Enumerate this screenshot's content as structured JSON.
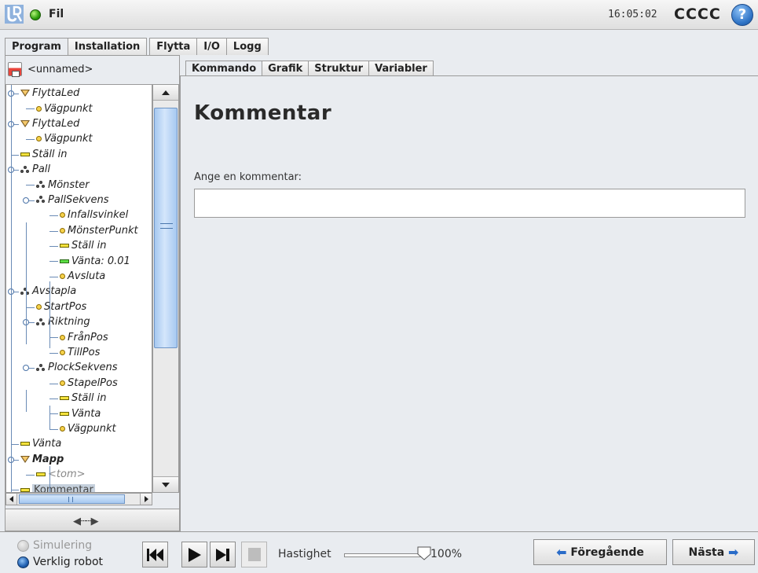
{
  "topbar": {
    "menu_label": "Fil",
    "clock": "16:05:02",
    "robot_name": "CCCC",
    "help_symbol": "?"
  },
  "main_tabs": [
    "Program",
    "Installation",
    "Flytta",
    "I/O",
    "Logg"
  ],
  "program": {
    "name": "<unnamed>"
  },
  "tree": [
    {
      "label": "FlyttaLed",
      "icon": "move-icon"
    },
    {
      "label": "Vägpunkt",
      "icon": "waypoint-icon"
    },
    {
      "label": "FlyttaLed",
      "icon": "move-icon"
    },
    {
      "label": "Vägpunkt",
      "icon": "waypoint-icon"
    },
    {
      "label": "Ställ in",
      "icon": "set-icon"
    },
    {
      "label": "Pall",
      "icon": "pallet-icon"
    },
    {
      "label": "Mönster",
      "icon": "pallet-icon"
    },
    {
      "label": "PallSekvens",
      "icon": "pallet-icon"
    },
    {
      "label": "Infallsvinkel",
      "icon": "waypoint-icon"
    },
    {
      "label": "MönsterPunkt",
      "icon": "waypoint-icon"
    },
    {
      "label": "Ställ in",
      "icon": "set-icon"
    },
    {
      "label": "Vänta: 0.01",
      "icon": "wait-icon"
    },
    {
      "label": "Avsluta",
      "icon": "waypoint-icon"
    },
    {
      "label": "Avstapla",
      "icon": "pallet-icon"
    },
    {
      "label": "StartPos",
      "icon": "waypoint-icon"
    },
    {
      "label": "Riktning",
      "icon": "pallet-icon"
    },
    {
      "label": "FrånPos",
      "icon": "waypoint-icon"
    },
    {
      "label": "TillPos",
      "icon": "waypoint-icon"
    },
    {
      "label": "PlockSekvens",
      "icon": "pallet-icon"
    },
    {
      "label": "StapelPos",
      "icon": "waypoint-icon"
    },
    {
      "label": "Ställ in",
      "icon": "set-icon"
    },
    {
      "label": "Vänta",
      "icon": "set-icon"
    },
    {
      "label": "Vägpunkt",
      "icon": "waypoint-icon"
    },
    {
      "label": "Vänta",
      "icon": "set-icon"
    },
    {
      "label": "Mapp",
      "icon": "folder-icon"
    },
    {
      "label": "<tom>",
      "icon": "set-icon"
    },
    {
      "label": "Kommentar",
      "icon": "set-icon"
    }
  ],
  "sub_tabs": [
    "Kommando",
    "Grafik",
    "Struktur",
    "Variabler"
  ],
  "command": {
    "title": "Kommentar",
    "field_label": "Ange en kommentar:",
    "field_value": ""
  },
  "bottom": {
    "mode_simulation": "Simulering",
    "mode_real": "Verklig robot",
    "speed_label": "Hastighet",
    "speed_value": "100%",
    "speed_fraction": 1.0,
    "prev_label": "Föregående",
    "next_label": "Nästa"
  },
  "colors": {
    "accent_blue": "#2f74c6",
    "status_green": "#2c9d0c",
    "selection": "#c5d0dc"
  }
}
